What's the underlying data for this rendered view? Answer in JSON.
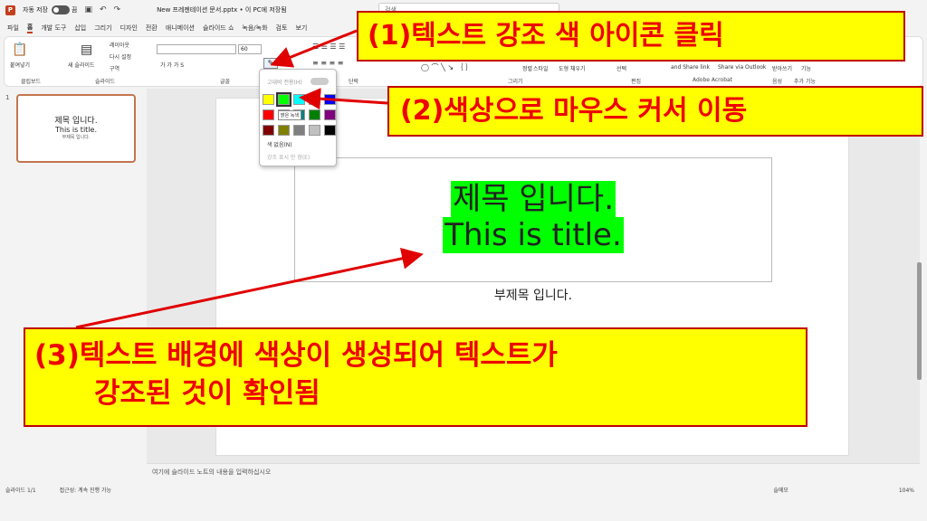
{
  "titlebar": {
    "autosave_label": "자동 저장",
    "toggle_state": "끔",
    "doc_title": "New 프레젠테이션 문서.pptx • 이 PC에 저장됨",
    "search_placeholder": "검색"
  },
  "menu": [
    "파일",
    "홈",
    "개발 도구",
    "삽입",
    "그리기",
    "디자인",
    "전환",
    "애니메이션",
    "슬라이드 쇼",
    "녹음/녹화",
    "검토",
    "보기"
  ],
  "ribbon": {
    "paste": "붙여넣기",
    "new_slide": "새 슬라이드",
    "layout": "레이아웃",
    "reset": "다시 설정",
    "section": "구역",
    "font_size": "60",
    "highlight_icon": "pen-icon",
    "groups": {
      "clipboard": "클립보드",
      "slides": "슬라이드",
      "font": "글꼴",
      "paragraph": "단락",
      "drawing": "그리기",
      "editing": "편집",
      "acrobat": "Adobe Acrobat",
      "voice": "음성",
      "addins": "추가 기능"
    },
    "arrange": "정렬",
    "quick_styles": "스타일",
    "shape_format": "도형 채우기",
    "select": "선택",
    "share_link": "and Share link",
    "share_outlook": "Share via Outlook",
    "dictate": "받아쓰기",
    "addin": "기능"
  },
  "dropdown": {
    "continuous_label": "고대비 전용(H)",
    "tooltip": "밝은 녹색",
    "no_color": "색 없음(N)",
    "stop": "강조 표시 안 함(E)",
    "swatches": [
      "#ffff00",
      "#00ff00",
      "#00ffff",
      "#ff00ff",
      "#0000ff",
      "#ff0000",
      "#000080",
      "#008080",
      "#008000",
      "#800080",
      "#800000",
      "#808000",
      "#808080",
      "#c0c0c0",
      "#000000"
    ]
  },
  "thumbnail": {
    "number": "1",
    "line1": "제목 입니다.",
    "line2": "This is title.",
    "line3": "부제목 입니다."
  },
  "slide": {
    "title_line1": "제목 입니다.",
    "title_line2": "This is title.",
    "subtitle": "부제목 입니다.",
    "highlight_color": "#00ff00"
  },
  "notes_placeholder": "여기에 슬라이드 노트의 내용을 입력하십시오",
  "status": {
    "slide": "슬라이드 1/1",
    "accessibility": "접근성: 계속 진행 가능",
    "notes": "슬메모",
    "zoom": "104%"
  },
  "callouts": {
    "step1": "(1)텍스트 강조 색 아이콘 클릭",
    "step2": "(2)색상으로 마우스 커서 이동",
    "step3_line1": "(3)텍스트 배경에 색상이 생성되어 텍스트가",
    "step3_line2": "강조된 것이 확인됨"
  }
}
